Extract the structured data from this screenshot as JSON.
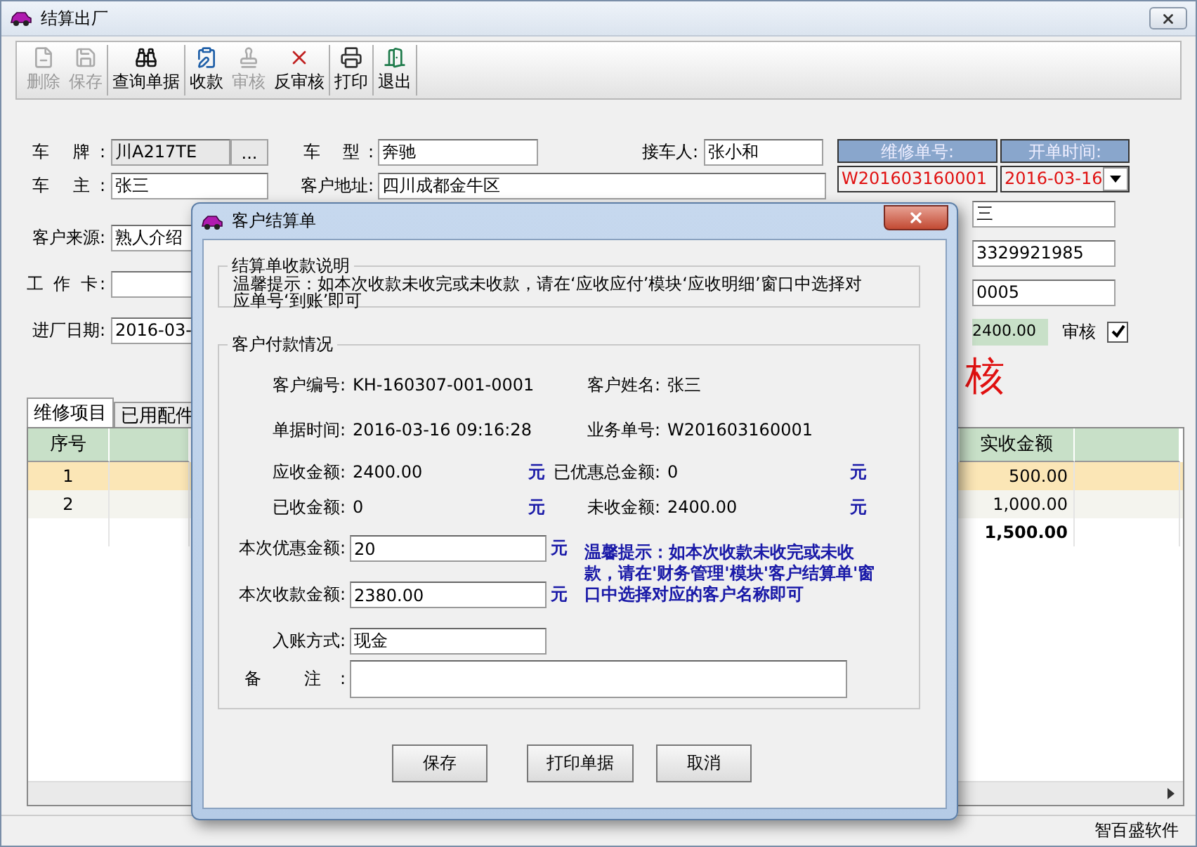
{
  "window": {
    "title": "结算出厂"
  },
  "toolbar": [
    {
      "label": "删除",
      "disabled": true
    },
    {
      "label": "保存",
      "disabled": true
    },
    {
      "label": "查询单据",
      "disabled": false
    },
    {
      "label": "收款",
      "disabled": false
    },
    {
      "label": "审核",
      "disabled": true
    },
    {
      "label": "反审核",
      "disabled": false
    },
    {
      "label": "打印",
      "disabled": false
    },
    {
      "label": "退出",
      "disabled": false
    }
  ],
  "form": {
    "plate": {
      "label": "车 牌:",
      "value": "川A217TE",
      "button": "..."
    },
    "model": {
      "label": "车 型:",
      "value": "奔驰"
    },
    "receiver": {
      "label": "接车人:",
      "value": "张小和"
    },
    "owner": {
      "label": "车 主:",
      "value": "张三"
    },
    "address": {
      "label": "客户地址:",
      "value": "四川成都金牛区"
    },
    "left_fields": [
      {
        "label": "客户来源:",
        "value": "熟人介绍"
      },
      {
        "label": "工 作 卡:"
      },
      {
        "label": "进厂日期:",
        "value": "2016-03-"
      }
    ],
    "right_fields": [
      {
        "value": "三"
      },
      {
        "value": "3329921985"
      },
      {
        "value": "0005"
      }
    ],
    "amount": "2400.00",
    "audit": {
      "label": "审核",
      "checked": true
    },
    "stamp": "核"
  },
  "order_header": {
    "columns": [
      "维修单号:",
      "开单时间:"
    ],
    "order_no": "W201603160001",
    "date": "2016-03-16"
  },
  "tabs": [
    {
      "label": "维修项目",
      "selected": true
    },
    {
      "label": "已用配件",
      "selected": false
    }
  ],
  "table": {
    "columns": [
      "序号",
      "实收金额"
    ],
    "rows": [
      {
        "index": "1",
        "amount": "500.00",
        "selected": true
      },
      {
        "index": "2",
        "amount": "1,000.00",
        "selected": false
      }
    ],
    "total": "1,500.00"
  },
  "status_bar": "智百盛软件",
  "dialog": {
    "title": "客户结算单",
    "notice": {
      "title": "结算单收款说明",
      "text": "温馨提示：如本次收款未收完或未收款，请在‘应收应付’模块‘应收明细’窗口中选择对应单号‘到账’即可"
    },
    "payment": {
      "title": "客户付款情况",
      "rows": [
        [
          {
            "label": "客户编号:",
            "value": "KH-160307-001-0001"
          },
          {
            "label": "客户姓名:",
            "value": "张三"
          }
        ],
        [
          {
            "label": "单据时间:",
            "value": "2016-03-16 09:16:28"
          },
          {
            "label": "业务单号:",
            "value": "W201603160001"
          }
        ],
        [
          {
            "label": "应收金额:",
            "value": "2400.00",
            "unit": "元"
          },
          {
            "label": "已优惠总金额:",
            "value": "0",
            "unit": "元"
          }
        ],
        [
          {
            "label": "已收金额:",
            "value": "0",
            "unit": "元"
          },
          {
            "label": "未收金额:",
            "value": "2400.00",
            "unit": "元"
          }
        ]
      ],
      "inputs": [
        {
          "label": "本次优惠金额:",
          "value": "20",
          "unit": "元"
        },
        {
          "label": "本次收款金额:",
          "value": "2380.00",
          "unit": "元"
        },
        {
          "label": "入账方式:",
          "value": "现金"
        }
      ],
      "tip": "温馨提示：如本次收款未收完或未收款，请在'财务管理'模块'客户结算单'窗口中选择对应的客户名称即可",
      "remark": {
        "label": "备 注:"
      }
    },
    "buttons": [
      "保存",
      "打印单据",
      "取消"
    ]
  }
}
